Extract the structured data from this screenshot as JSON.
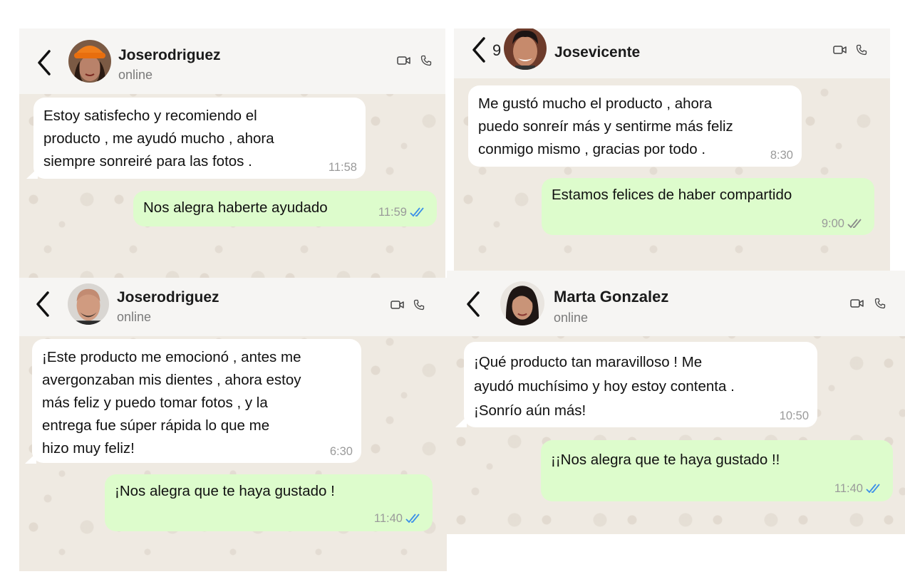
{
  "colors": {
    "incoming_bubble": "#ffffff",
    "outgoing_bubble": "#ddfccc",
    "read_tick": "#3b8fe8",
    "delivered_tick": "#8a8a8a",
    "chat_background": "#efeae2"
  },
  "chats": [
    {
      "contact_name": "Joserodriguez",
      "status": "online",
      "unread": "",
      "incoming": {
        "text": "Estoy satisfecho  y recomiendo  el\nproducto  , me ayudó  mucho , ahora\nsiempre  sonreiré  para las fotos .",
        "time": "11:58"
      },
      "outgoing": {
        "text": "Nos alegra haberte  ayudado",
        "time": "11:59",
        "tick": "read"
      }
    },
    {
      "contact_name": "Josevicente",
      "status": "",
      "unread": "9",
      "incoming": {
        "text": "Me gustó  mucho  el producto  , ahora\npuedo  sonreír  más y sentirme  más feliz\nconmigo  mismo , gracias por  todo .",
        "time": "8:30"
      },
      "outgoing": {
        "text": "Estamos felices de haber  compartido",
        "time": "9:00",
        "tick": "delivered"
      }
    },
    {
      "contact_name": "Joserodriguez",
      "status": "online",
      "unread": "",
      "incoming": {
        "text": "¡Este producto  me emocionó , antes me\navergonzaban  mis dientes , ahora  estoy\nmás feliz  y puedo  tomar  fotos , y la\nentrega  fue  súper  rápida  lo que me\nhizo muy  feliz!",
        "time": "6:30"
      },
      "outgoing": {
        "text": "¡Nos alegra que te haya gustado !",
        "time": "11:40",
        "tick": "read"
      }
    },
    {
      "contact_name": "Marta  Gonzalez",
      "status": "online",
      "unread": "",
      "incoming": {
        "text": "¡Qué producto  tan maravilloso ! Me\nayudó  muchísimo  y hoy estoy contenta .\n¡Sonrío aún más!",
        "time": "10:50"
      },
      "outgoing": {
        "text": "¡¡Nos alegra que te haya gustado !!",
        "time": "11:40",
        "tick": "read"
      }
    }
  ]
}
